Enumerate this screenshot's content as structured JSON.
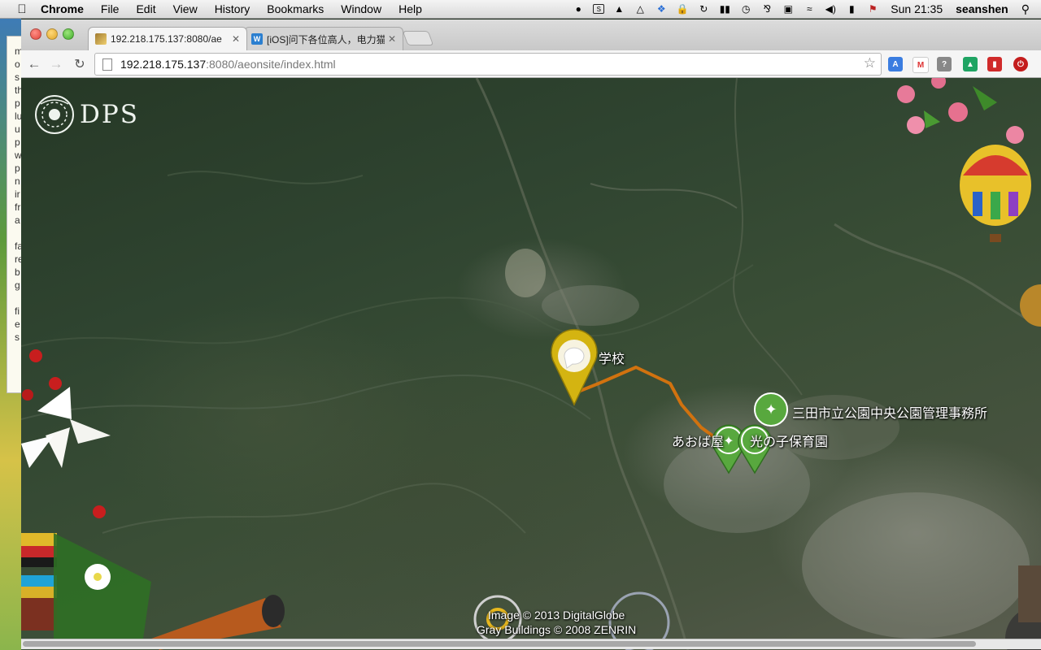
{
  "menubar": {
    "app_name": "Chrome",
    "items": [
      "File",
      "Edit",
      "View",
      "History",
      "Bookmarks",
      "Window",
      "Help"
    ],
    "clock": "Sun 21:35",
    "user": "seanshen"
  },
  "browser": {
    "tabs": [
      {
        "title": "192.218.175.137:8080/ae"
      },
      {
        "title": "[iOS]问下各位高人，电力猫迷"
      }
    ],
    "url_host": "192.218.175.137",
    "url_rest": ":8080/aeonsite/index.html"
  },
  "map": {
    "logo_text": "DPS",
    "pins": [
      {
        "label": "学校",
        "color": "#d4b411"
      },
      {
        "label": "三田市立公園中央公園管理事務所",
        "color": "#58a83e"
      },
      {
        "label": "あおば屋",
        "color": "#58a83e"
      },
      {
        "label": "光の子保育園",
        "color": "#58a83e"
      }
    ],
    "route_color": "#d1720f",
    "copyright_lines": [
      "Image © 2013 DigitalGlobe",
      "Gray Buildings © 2008 ZENRIN"
    ]
  },
  "background_doc_lines": [
    "m",
    "o",
    "s",
    "th",
    "p",
    "lu",
    "u",
    "p",
    "w",
    "p",
    "n",
    "ir",
    "fr",
    "a",
    "",
    "fa",
    "re",
    "b",
    "g",
    "",
    "fi",
    "e",
    "s"
  ]
}
